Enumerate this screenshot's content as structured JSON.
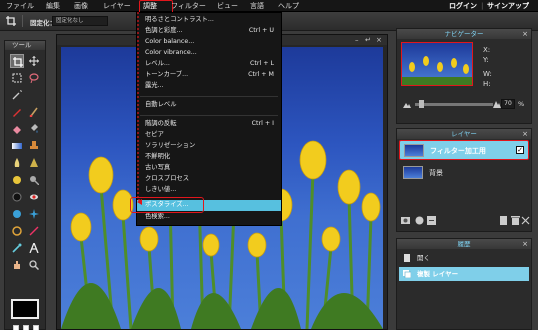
{
  "menubar": {
    "items": [
      "ファイル",
      "編集",
      "画像",
      "レイヤー",
      "調整",
      "フィルター",
      "ビュー",
      "言語",
      "ヘルプ"
    ],
    "active_index": 4,
    "login": "ログイン",
    "signup": "サインアップ"
  },
  "optionsbar": {
    "label": "固定化：",
    "select_value": "固定化なし"
  },
  "tools_panel": {
    "title": "ツール"
  },
  "document": {
    "min": "–",
    "max": "↵",
    "close": "×"
  },
  "adjust_menu": {
    "items": [
      {
        "label": "明るさとコントラスト...",
        "shortcut": ""
      },
      {
        "label": "色調と彩度...",
        "shortcut": "Ctrl + U"
      },
      {
        "label": "Color balance...",
        "shortcut": ""
      },
      {
        "label": "Color vibrance...",
        "shortcut": ""
      },
      {
        "label": "レベル...",
        "shortcut": "Ctrl + L"
      },
      {
        "label": "トーンカーブ...",
        "shortcut": "Ctrl + M"
      },
      {
        "label": "露光...",
        "shortcut": ""
      },
      {
        "label": "自動レベル",
        "shortcut": ""
      },
      {
        "label": "階調の反転",
        "shortcut": "Ctrl + I"
      },
      {
        "label": "セピア",
        "shortcut": ""
      },
      {
        "label": "ソラリゼーション",
        "shortcut": ""
      },
      {
        "label": "不鮮明化",
        "shortcut": ""
      },
      {
        "label": "古い写真",
        "shortcut": ""
      },
      {
        "label": "クロスプロセス",
        "shortcut": ""
      },
      {
        "label": "しきい値...",
        "shortcut": ""
      },
      {
        "label": "ポスタライズ...",
        "shortcut": ""
      },
      {
        "label": "色検索...",
        "shortcut": ""
      }
    ],
    "highlighted_index": 15
  },
  "navigator": {
    "title": "ナビゲーター",
    "x_label": "X:",
    "y_label": "Y:",
    "w_label": "W:",
    "h_label": "H:",
    "zoom_value": "70",
    "zoom_unit": "%"
  },
  "layers": {
    "title": "レイヤー",
    "items": [
      {
        "name": "フィルター加工用",
        "active": true,
        "checked": true
      },
      {
        "name": "背景",
        "active": false,
        "checked": false
      }
    ]
  },
  "history": {
    "title": "履歴",
    "items": [
      {
        "name": "開く",
        "active": false
      },
      {
        "name": "複製 レイヤー",
        "active": true
      }
    ]
  },
  "colors": {
    "accent": "#7fcfe9",
    "annotation_red": "#e2161c",
    "sky_blue": "#2d56c0",
    "tulip_yellow": "#f2cc1e"
  }
}
